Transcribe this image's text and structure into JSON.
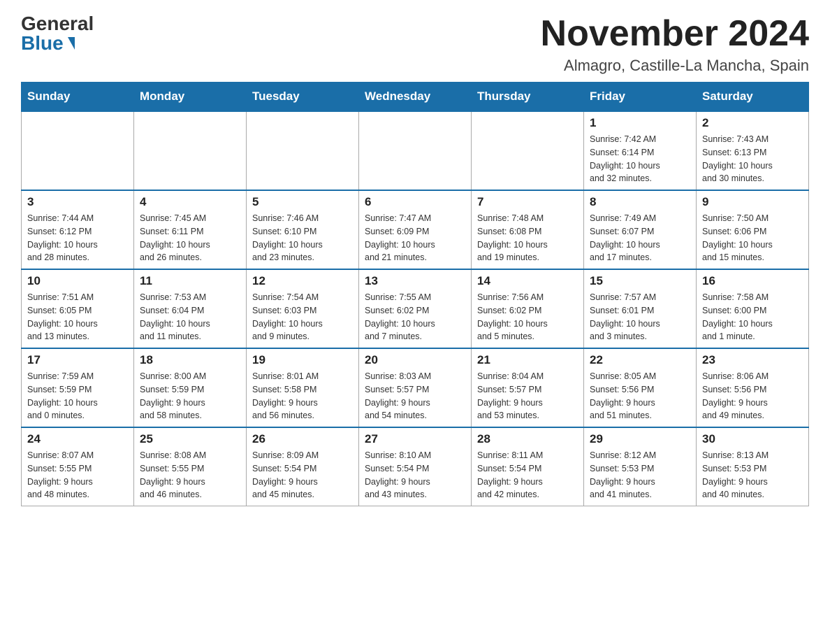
{
  "header": {
    "logo_general": "General",
    "logo_blue": "Blue",
    "month_title": "November 2024",
    "location": "Almagro, Castille-La Mancha, Spain"
  },
  "weekdays": [
    "Sunday",
    "Monday",
    "Tuesday",
    "Wednesday",
    "Thursday",
    "Friday",
    "Saturday"
  ],
  "weeks": [
    [
      {
        "day": "",
        "info": ""
      },
      {
        "day": "",
        "info": ""
      },
      {
        "day": "",
        "info": ""
      },
      {
        "day": "",
        "info": ""
      },
      {
        "day": "",
        "info": ""
      },
      {
        "day": "1",
        "info": "Sunrise: 7:42 AM\nSunset: 6:14 PM\nDaylight: 10 hours\nand 32 minutes."
      },
      {
        "day": "2",
        "info": "Sunrise: 7:43 AM\nSunset: 6:13 PM\nDaylight: 10 hours\nand 30 minutes."
      }
    ],
    [
      {
        "day": "3",
        "info": "Sunrise: 7:44 AM\nSunset: 6:12 PM\nDaylight: 10 hours\nand 28 minutes."
      },
      {
        "day": "4",
        "info": "Sunrise: 7:45 AM\nSunset: 6:11 PM\nDaylight: 10 hours\nand 26 minutes."
      },
      {
        "day": "5",
        "info": "Sunrise: 7:46 AM\nSunset: 6:10 PM\nDaylight: 10 hours\nand 23 minutes."
      },
      {
        "day": "6",
        "info": "Sunrise: 7:47 AM\nSunset: 6:09 PM\nDaylight: 10 hours\nand 21 minutes."
      },
      {
        "day": "7",
        "info": "Sunrise: 7:48 AM\nSunset: 6:08 PM\nDaylight: 10 hours\nand 19 minutes."
      },
      {
        "day": "8",
        "info": "Sunrise: 7:49 AM\nSunset: 6:07 PM\nDaylight: 10 hours\nand 17 minutes."
      },
      {
        "day": "9",
        "info": "Sunrise: 7:50 AM\nSunset: 6:06 PM\nDaylight: 10 hours\nand 15 minutes."
      }
    ],
    [
      {
        "day": "10",
        "info": "Sunrise: 7:51 AM\nSunset: 6:05 PM\nDaylight: 10 hours\nand 13 minutes."
      },
      {
        "day": "11",
        "info": "Sunrise: 7:53 AM\nSunset: 6:04 PM\nDaylight: 10 hours\nand 11 minutes."
      },
      {
        "day": "12",
        "info": "Sunrise: 7:54 AM\nSunset: 6:03 PM\nDaylight: 10 hours\nand 9 minutes."
      },
      {
        "day": "13",
        "info": "Sunrise: 7:55 AM\nSunset: 6:02 PM\nDaylight: 10 hours\nand 7 minutes."
      },
      {
        "day": "14",
        "info": "Sunrise: 7:56 AM\nSunset: 6:02 PM\nDaylight: 10 hours\nand 5 minutes."
      },
      {
        "day": "15",
        "info": "Sunrise: 7:57 AM\nSunset: 6:01 PM\nDaylight: 10 hours\nand 3 minutes."
      },
      {
        "day": "16",
        "info": "Sunrise: 7:58 AM\nSunset: 6:00 PM\nDaylight: 10 hours\nand 1 minute."
      }
    ],
    [
      {
        "day": "17",
        "info": "Sunrise: 7:59 AM\nSunset: 5:59 PM\nDaylight: 10 hours\nand 0 minutes."
      },
      {
        "day": "18",
        "info": "Sunrise: 8:00 AM\nSunset: 5:59 PM\nDaylight: 9 hours\nand 58 minutes."
      },
      {
        "day": "19",
        "info": "Sunrise: 8:01 AM\nSunset: 5:58 PM\nDaylight: 9 hours\nand 56 minutes."
      },
      {
        "day": "20",
        "info": "Sunrise: 8:03 AM\nSunset: 5:57 PM\nDaylight: 9 hours\nand 54 minutes."
      },
      {
        "day": "21",
        "info": "Sunrise: 8:04 AM\nSunset: 5:57 PM\nDaylight: 9 hours\nand 53 minutes."
      },
      {
        "day": "22",
        "info": "Sunrise: 8:05 AM\nSunset: 5:56 PM\nDaylight: 9 hours\nand 51 minutes."
      },
      {
        "day": "23",
        "info": "Sunrise: 8:06 AM\nSunset: 5:56 PM\nDaylight: 9 hours\nand 49 minutes."
      }
    ],
    [
      {
        "day": "24",
        "info": "Sunrise: 8:07 AM\nSunset: 5:55 PM\nDaylight: 9 hours\nand 48 minutes."
      },
      {
        "day": "25",
        "info": "Sunrise: 8:08 AM\nSunset: 5:55 PM\nDaylight: 9 hours\nand 46 minutes."
      },
      {
        "day": "26",
        "info": "Sunrise: 8:09 AM\nSunset: 5:54 PM\nDaylight: 9 hours\nand 45 minutes."
      },
      {
        "day": "27",
        "info": "Sunrise: 8:10 AM\nSunset: 5:54 PM\nDaylight: 9 hours\nand 43 minutes."
      },
      {
        "day": "28",
        "info": "Sunrise: 8:11 AM\nSunset: 5:54 PM\nDaylight: 9 hours\nand 42 minutes."
      },
      {
        "day": "29",
        "info": "Sunrise: 8:12 AM\nSunset: 5:53 PM\nDaylight: 9 hours\nand 41 minutes."
      },
      {
        "day": "30",
        "info": "Sunrise: 8:13 AM\nSunset: 5:53 PM\nDaylight: 9 hours\nand 40 minutes."
      }
    ]
  ]
}
